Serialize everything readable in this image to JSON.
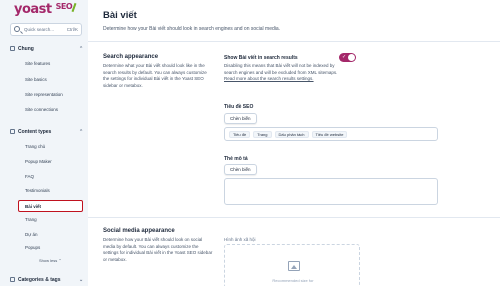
{
  "brand": {
    "name": "yoast",
    "suffix": "SEO"
  },
  "search": {
    "placeholder": "Quick search...",
    "shortcut": "Ctrl/K"
  },
  "sidebar": {
    "general": {
      "label": "Chung",
      "items": [
        "Site features",
        "Site basics",
        "Site representation",
        "Site connections"
      ]
    },
    "content_types": {
      "label": "Content types",
      "items": [
        "Trang chủ",
        "Popup Maker",
        "FAQ",
        "Testimonials",
        "Bài viết",
        "Trang",
        "Dự án",
        "Popups"
      ],
      "active": "Bài viết"
    },
    "show_less": "Show less",
    "categories": {
      "label": "Categories & tags"
    }
  },
  "page": {
    "title": "Bài viết",
    "subtitle": "Determine how your Bài viết should look in search engines and on social media."
  },
  "search_appearance": {
    "title": "Search appearance",
    "description": "Determine what your Bài viết should look like in the search results by default. You can always customize the settings for individual Bài viết in the Yoast SEO sidebar or metabox.",
    "toggle_label": "Show Bài viết in search results",
    "toggle_on": true,
    "toggle_description": "Disabling this means that Bài viết will not be indexed by search engines and will be excluded from XML sitemaps.",
    "toggle_link": "Read more about the search results settings.",
    "seo_title_label": "Tiêu đề SEO",
    "insert_variable": "Chèn biến",
    "seo_title_chips": [
      "Tiêu đề",
      "Trang",
      "Dấu phân tách",
      "Tiêu đề website"
    ],
    "meta_desc_label": "Thẻ mô tả",
    "insert_variable_2": "Chèn biến"
  },
  "social_appearance": {
    "title": "Social media appearance",
    "description": "Determine how your Bài viết should look on social media by default. You can always customize the settings for individual Bài viết in the Yoast SEO sidebar or metabox.",
    "image_label": "Hình ảnh xã hội",
    "image_hint": "Recommended size for"
  },
  "colors": {
    "brand": "#a4286a",
    "active_outline": "#c0121f"
  }
}
